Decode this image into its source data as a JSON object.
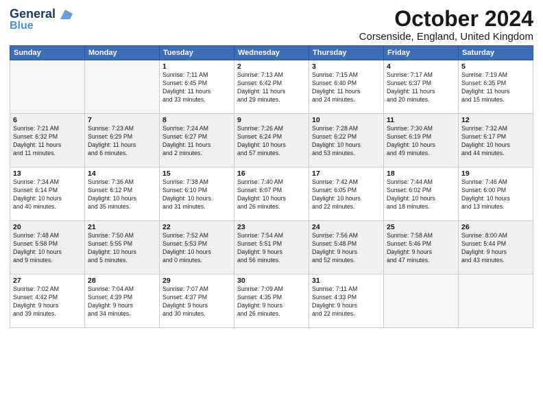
{
  "logo": {
    "line1": "General",
    "line2": "Blue"
  },
  "title": "October 2024",
  "location": "Corsenside, England, United Kingdom",
  "weekdays": [
    "Sunday",
    "Monday",
    "Tuesday",
    "Wednesday",
    "Thursday",
    "Friday",
    "Saturday"
  ],
  "weeks": [
    [
      {
        "day": "",
        "info": ""
      },
      {
        "day": "",
        "info": ""
      },
      {
        "day": "1",
        "info": "Sunrise: 7:11 AM\nSunset: 6:45 PM\nDaylight: 11 hours\nand 33 minutes."
      },
      {
        "day": "2",
        "info": "Sunrise: 7:13 AM\nSunset: 6:42 PM\nDaylight: 11 hours\nand 29 minutes."
      },
      {
        "day": "3",
        "info": "Sunrise: 7:15 AM\nSunset: 6:40 PM\nDaylight: 11 hours\nand 24 minutes."
      },
      {
        "day": "4",
        "info": "Sunrise: 7:17 AM\nSunset: 6:37 PM\nDaylight: 11 hours\nand 20 minutes."
      },
      {
        "day": "5",
        "info": "Sunrise: 7:19 AM\nSunset: 6:35 PM\nDaylight: 11 hours\nand 15 minutes."
      }
    ],
    [
      {
        "day": "6",
        "info": "Sunrise: 7:21 AM\nSunset: 6:32 PM\nDaylight: 11 hours\nand 11 minutes."
      },
      {
        "day": "7",
        "info": "Sunrise: 7:23 AM\nSunset: 6:29 PM\nDaylight: 11 hours\nand 6 minutes."
      },
      {
        "day": "8",
        "info": "Sunrise: 7:24 AM\nSunset: 6:27 PM\nDaylight: 11 hours\nand 2 minutes."
      },
      {
        "day": "9",
        "info": "Sunrise: 7:26 AM\nSunset: 6:24 PM\nDaylight: 10 hours\nand 57 minutes."
      },
      {
        "day": "10",
        "info": "Sunrise: 7:28 AM\nSunset: 6:22 PM\nDaylight: 10 hours\nand 53 minutes."
      },
      {
        "day": "11",
        "info": "Sunrise: 7:30 AM\nSunset: 6:19 PM\nDaylight: 10 hours\nand 49 minutes."
      },
      {
        "day": "12",
        "info": "Sunrise: 7:32 AM\nSunset: 6:17 PM\nDaylight: 10 hours\nand 44 minutes."
      }
    ],
    [
      {
        "day": "13",
        "info": "Sunrise: 7:34 AM\nSunset: 6:14 PM\nDaylight: 10 hours\nand 40 minutes."
      },
      {
        "day": "14",
        "info": "Sunrise: 7:36 AM\nSunset: 6:12 PM\nDaylight: 10 hours\nand 35 minutes."
      },
      {
        "day": "15",
        "info": "Sunrise: 7:38 AM\nSunset: 6:10 PM\nDaylight: 10 hours\nand 31 minutes."
      },
      {
        "day": "16",
        "info": "Sunrise: 7:40 AM\nSunset: 6:07 PM\nDaylight: 10 hours\nand 26 minutes."
      },
      {
        "day": "17",
        "info": "Sunrise: 7:42 AM\nSunset: 6:05 PM\nDaylight: 10 hours\nand 22 minutes."
      },
      {
        "day": "18",
        "info": "Sunrise: 7:44 AM\nSunset: 6:02 PM\nDaylight: 10 hours\nand 18 minutes."
      },
      {
        "day": "19",
        "info": "Sunrise: 7:46 AM\nSunset: 6:00 PM\nDaylight: 10 hours\nand 13 minutes."
      }
    ],
    [
      {
        "day": "20",
        "info": "Sunrise: 7:48 AM\nSunset: 5:58 PM\nDaylight: 10 hours\nand 9 minutes."
      },
      {
        "day": "21",
        "info": "Sunrise: 7:50 AM\nSunset: 5:55 PM\nDaylight: 10 hours\nand 5 minutes."
      },
      {
        "day": "22",
        "info": "Sunrise: 7:52 AM\nSunset: 5:53 PM\nDaylight: 10 hours\nand 0 minutes."
      },
      {
        "day": "23",
        "info": "Sunrise: 7:54 AM\nSunset: 5:51 PM\nDaylight: 9 hours\nand 56 minutes."
      },
      {
        "day": "24",
        "info": "Sunrise: 7:56 AM\nSunset: 5:48 PM\nDaylight: 9 hours\nand 52 minutes."
      },
      {
        "day": "25",
        "info": "Sunrise: 7:58 AM\nSunset: 5:46 PM\nDaylight: 9 hours\nand 47 minutes."
      },
      {
        "day": "26",
        "info": "Sunrise: 8:00 AM\nSunset: 5:44 PM\nDaylight: 9 hours\nand 43 minutes."
      }
    ],
    [
      {
        "day": "27",
        "info": "Sunrise: 7:02 AM\nSunset: 4:42 PM\nDaylight: 9 hours\nand 39 minutes."
      },
      {
        "day": "28",
        "info": "Sunrise: 7:04 AM\nSunset: 4:39 PM\nDaylight: 9 hours\nand 34 minutes."
      },
      {
        "day": "29",
        "info": "Sunrise: 7:07 AM\nSunset: 4:37 PM\nDaylight: 9 hours\nand 30 minutes."
      },
      {
        "day": "30",
        "info": "Sunrise: 7:09 AM\nSunset: 4:35 PM\nDaylight: 9 hours\nand 26 minutes."
      },
      {
        "day": "31",
        "info": "Sunrise: 7:11 AM\nSunset: 4:33 PM\nDaylight: 9 hours\nand 22 minutes."
      },
      {
        "day": "",
        "info": ""
      },
      {
        "day": "",
        "info": ""
      }
    ]
  ]
}
